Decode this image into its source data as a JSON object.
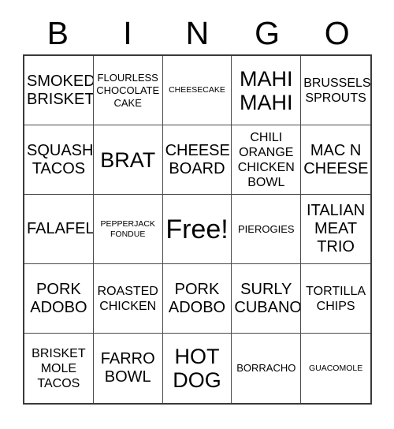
{
  "card": {
    "title": "BINGO",
    "header_letters": [
      "B",
      "I",
      "N",
      "G",
      "O"
    ],
    "free_space_label": "Free!",
    "colors": {
      "background": "#ffffff",
      "text": "#000000",
      "grid_border": "#3a3a3a",
      "cell_border": "#4a4a4a"
    },
    "rows": [
      [
        {
          "text": "SMOKED\nBRISKET",
          "size": "sz-md"
        },
        {
          "text": "FLOURLESS\nCHOCOLATE\nCAKE",
          "size": "sz-xs"
        },
        {
          "text": "CHEESECAKE",
          "size": "sz-xxs"
        },
        {
          "text": "MAHI\nMAHI",
          "size": "sz-lg"
        },
        {
          "text": "BRUSSELS\nSPROUTS",
          "size": "sz-sm"
        }
      ],
      [
        {
          "text": "SQUASH\nTACOS",
          "size": "sz-md"
        },
        {
          "text": "BRAT",
          "size": "sz-lg"
        },
        {
          "text": "CHEESE\nBOARD",
          "size": "sz-md"
        },
        {
          "text": "CHILI\nORANGE\nCHICKEN\nBOWL",
          "size": "sz-sm"
        },
        {
          "text": "MAC N\nCHEESE",
          "size": "sz-md"
        }
      ],
      [
        {
          "text": "FALAFEL",
          "size": "sz-md"
        },
        {
          "text": "PEPPERJACK\nFONDUE",
          "size": "sz-xxs"
        },
        {
          "text": "Free!",
          "size": "sz-xl"
        },
        {
          "text": "PIEROGIES",
          "size": "sz-xs"
        },
        {
          "text": "ITALIAN\nMEAT\nTRIO",
          "size": "sz-md"
        }
      ],
      [
        {
          "text": "PORK\nADOBO",
          "size": "sz-md"
        },
        {
          "text": "ROASTED\nCHICKEN",
          "size": "sz-sm"
        },
        {
          "text": "PORK\nADOBO",
          "size": "sz-md"
        },
        {
          "text": "SURLY\nCUBANO",
          "size": "sz-md"
        },
        {
          "text": "TORTILLA\nCHIPS",
          "size": "sz-sm"
        }
      ],
      [
        {
          "text": "BRISKET\nMOLE\nTACOS",
          "size": "sz-sm"
        },
        {
          "text": "FARRO\nBOWL",
          "size": "sz-md"
        },
        {
          "text": "HOT\nDOG",
          "size": "sz-lg"
        },
        {
          "text": "BORRACHO",
          "size": "sz-xs"
        },
        {
          "text": "GUACOMOLE",
          "size": "sz-xxs"
        }
      ]
    ]
  }
}
